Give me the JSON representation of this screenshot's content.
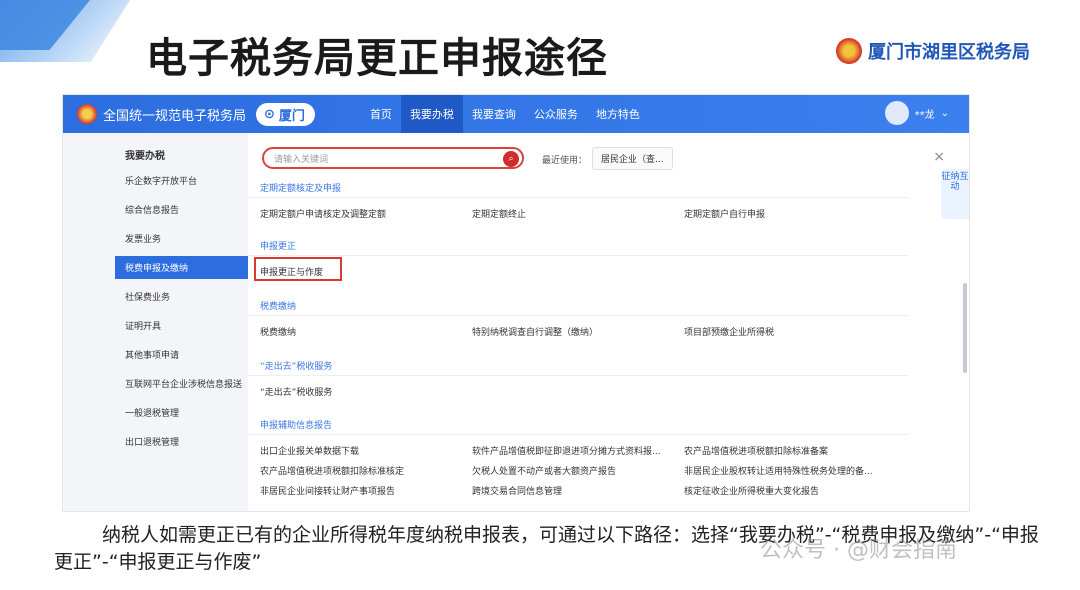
{
  "slide": {
    "title": "电子税务局更正申报途径",
    "brand": "厦门市湖里区税务局"
  },
  "portal": {
    "name": "全国统一规范电子税务局",
    "city": "厦门",
    "nav": [
      "首页",
      "我要办税",
      "我要查询",
      "公众服务",
      "地方特色"
    ],
    "user": "**龙"
  },
  "sidebar": {
    "header": "我要办税",
    "items": [
      "乐企数字开放平台",
      "综合信息报告",
      "发票业务",
      "税费申报及缴纳",
      "社保费业务",
      "证明开具",
      "其他事项申请",
      "互联网平台企业涉税信息报送",
      "一般退税管理",
      "出口退税管理"
    ]
  },
  "search": {
    "placeholder": "请输入关键词",
    "recent_label": "最近使用：",
    "recent_item": "居民企业（查..."
  },
  "mascot_text": "征纳互动",
  "sections": {
    "s1": "定期定额核定及申报",
    "s1_items": [
      "定期定额户申请核定及调整定额",
      "定期定额终止",
      "定期定额户自行申报"
    ],
    "s2": "申报更正",
    "s2_items": [
      "申报更正与作废"
    ],
    "s3": "税费缴纳",
    "s3_items": [
      "税费缴纳",
      "特别纳税调查自行调整（缴纳）",
      "项目部预缴企业所得税"
    ],
    "s4": "“走出去”税收服务",
    "s4_items": [
      "“走出去”税收服务"
    ],
    "s5": "申报辅助信息报告",
    "s5_items": [
      "出口企业报关单数据下载",
      "软件产品增值税即征即退进项分摊方式资料报...",
      "农产品增值税进项税额扣除标准备案",
      "农产品增值税进项税额扣除标准核定",
      "欠税人处置不动产或者大额资产报告",
      "非居民企业股权转让适用特殊性税务处理的备...",
      "非居民企业间接转让财产事项报告",
      "跨境交易合同信息管理",
      "核定征收企业所得税重大变化报告"
    ]
  },
  "caption": "纳税人如需更正已有的企业所得税年度纳税申报表，可通过以下路径：选择“我要办税”-“税费申报及缴纳”-“申报更正”-“申报更正与作废”",
  "watermark": "公众号 · @财会指南"
}
